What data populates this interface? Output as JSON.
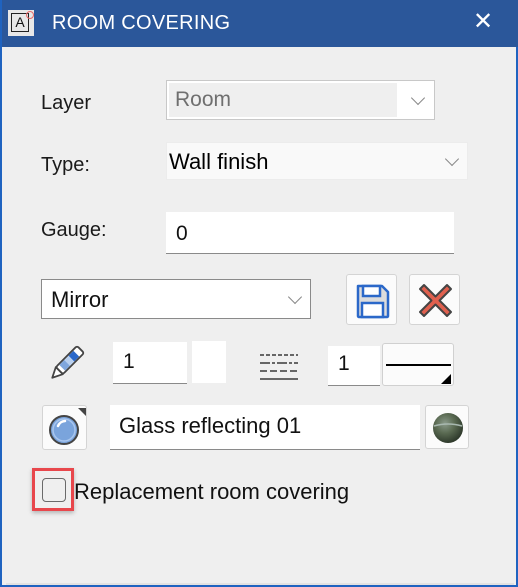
{
  "window": {
    "title": "ROOM COVERING",
    "app_icon": "room-covering-app-icon",
    "app_icon_letter": "A",
    "close_icon": "close-icon",
    "close_glyph": "✕"
  },
  "form": {
    "layer": {
      "label": "Layer",
      "value": "Room",
      "disabled": true
    },
    "type": {
      "label": "Type:",
      "value": "Wall finish"
    },
    "gauge": {
      "label": "Gauge:",
      "value": "0"
    },
    "preset": {
      "value": "Mirror"
    },
    "buttons": {
      "save_icon": "floppy-disk-icon",
      "delete_icon": "red-x-icon"
    },
    "pen": {
      "icon": "pen-icon",
      "width": "1"
    },
    "line": {
      "icon": "line-type-icon",
      "width": "1",
      "style": "solid"
    },
    "material": {
      "icon": "glass-sphere-icon",
      "name": "Glass reflecting 01",
      "texture_icon": "texture-preview-icon"
    },
    "replacement": {
      "label": "Replacement room covering",
      "checked": false
    }
  },
  "colors": {
    "titlebar": "#2b579a",
    "window_border": "#1f63c0",
    "background": "#efefef",
    "highlight": "#e8474c",
    "save_icon": "#2b68c9",
    "delete_icon": "#e0604e"
  }
}
